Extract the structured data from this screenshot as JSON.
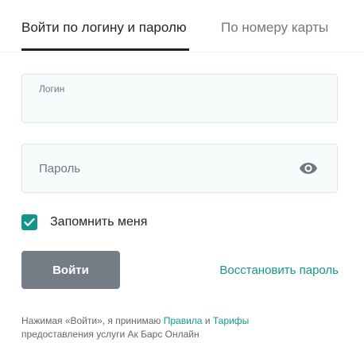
{
  "tabs": {
    "login": "Войти по логину и паролю",
    "card": "По номеру карты"
  },
  "login_field": {
    "label": "Логин",
    "value": ""
  },
  "password_field": {
    "label": "Пароль",
    "value": "",
    "toggle_icon": "eye-icon"
  },
  "remember": {
    "label": "Запомнить меня",
    "checked": true
  },
  "actions": {
    "submit_label": "Войти",
    "restore_label": "Восстановить пароль"
  },
  "legal": {
    "prefix": "Нажимая «Войти», я принимаю",
    "rules_link": "Правила",
    "conjunction": "и",
    "tariffs_link": "Тарифы",
    "suffix": "предоставления услуги Ак Барс Онлайн"
  },
  "colors": {
    "accent": "#13988b",
    "button": "#747d85",
    "text": "#1f2326",
    "muted": "#6f787f",
    "field_bg": "#f7fbfc",
    "field_border": "#dfe4e8"
  }
}
